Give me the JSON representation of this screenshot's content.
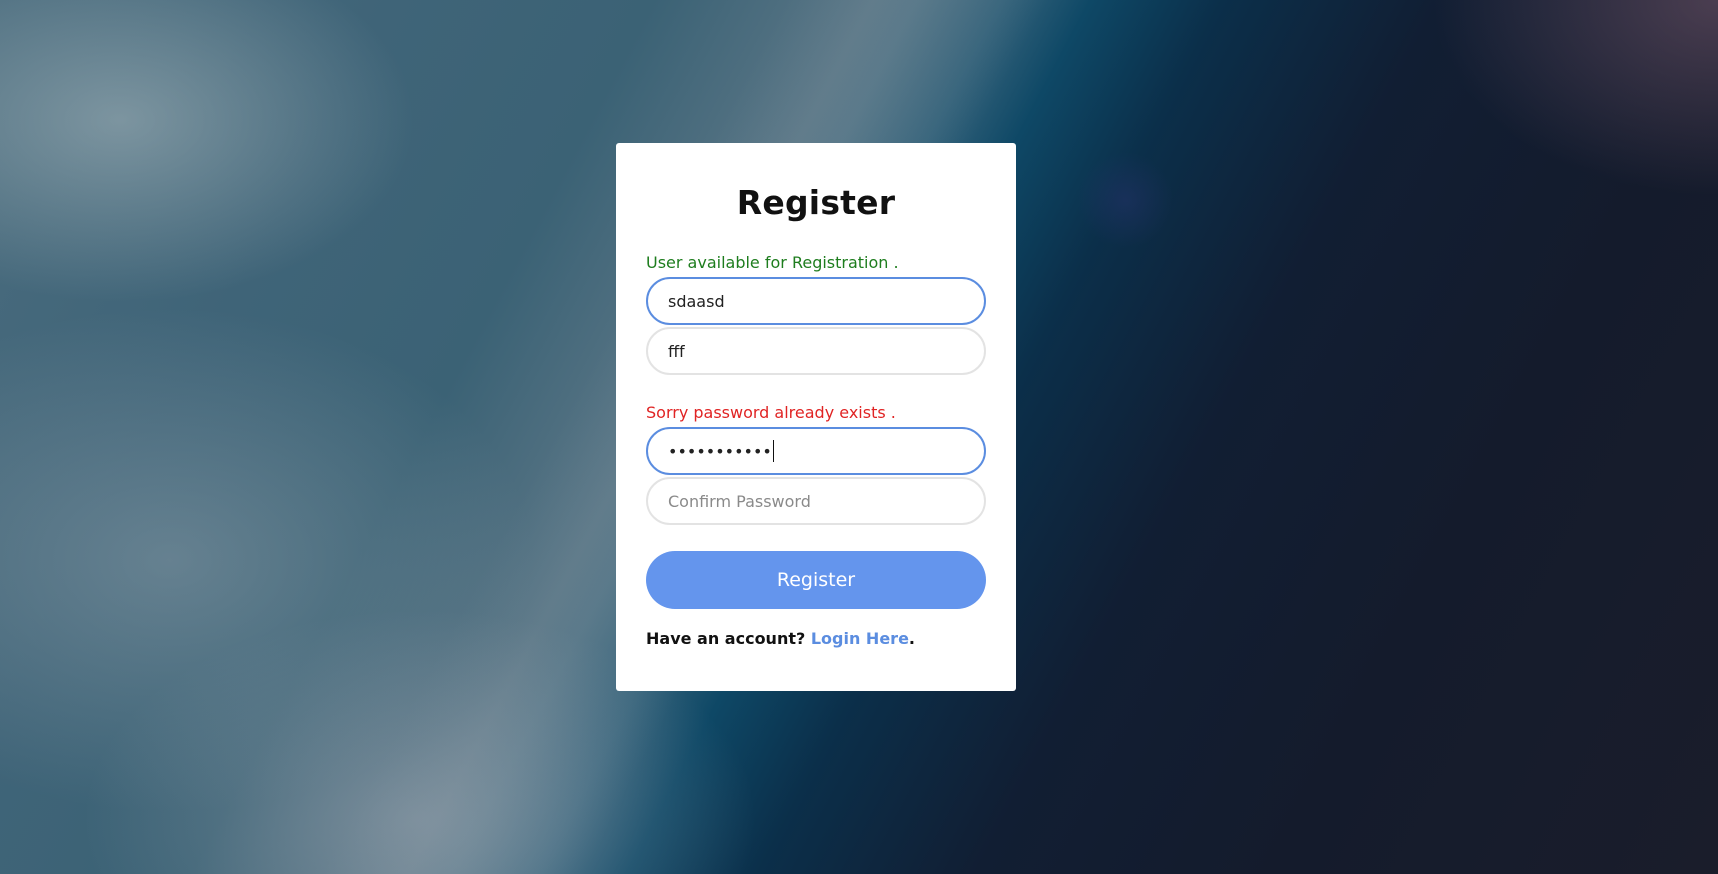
{
  "form": {
    "title": "Register",
    "username_status": "User available for Registration .",
    "username_value": "sdaasd",
    "email_value": "fff",
    "password_status": "Sorry password already exists .",
    "password_masked": "•••••••••••",
    "confirm_placeholder": "Confirm Password",
    "submit_label": "Register",
    "footer_prefix": "Have an account? ",
    "login_link": "Login Here",
    "footer_suffix": "."
  },
  "colors": {
    "accent": "#6495ed",
    "success": "#1e7d1e",
    "error": "#e02424"
  }
}
